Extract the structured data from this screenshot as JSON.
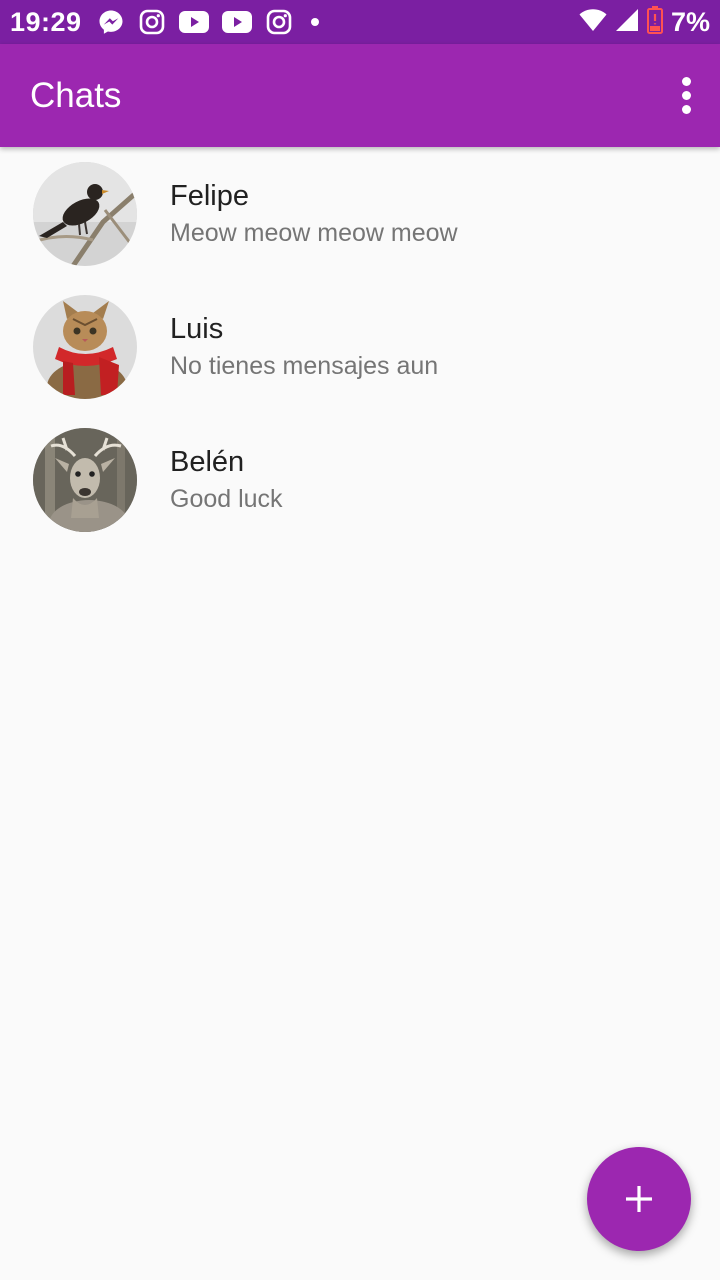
{
  "status_bar": {
    "time": "19:29",
    "notifications": [
      "messenger-icon",
      "instagram-icon",
      "youtube-icon",
      "youtube-icon",
      "instagram-icon",
      "dot"
    ],
    "battery_percent": "7%"
  },
  "app_bar": {
    "title": "Chats",
    "menu_icon": "more-vert-icon"
  },
  "chats": [
    {
      "name": "Felipe",
      "preview": "Meow meow meow meow",
      "avatar": "bird"
    },
    {
      "name": "Luis",
      "preview": "No tienes mensajes aun",
      "avatar": "cat"
    },
    {
      "name": "Belén",
      "preview": "Good luck",
      "avatar": "deer"
    }
  ],
  "fab": {
    "icon": "plus-icon"
  },
  "colors": {
    "status_bar": "#7b1fa2",
    "primary": "#9c27b0",
    "background": "#fafafa",
    "name_text": "#212121",
    "preview_text": "#757575",
    "battery_low": "#ff5252"
  }
}
